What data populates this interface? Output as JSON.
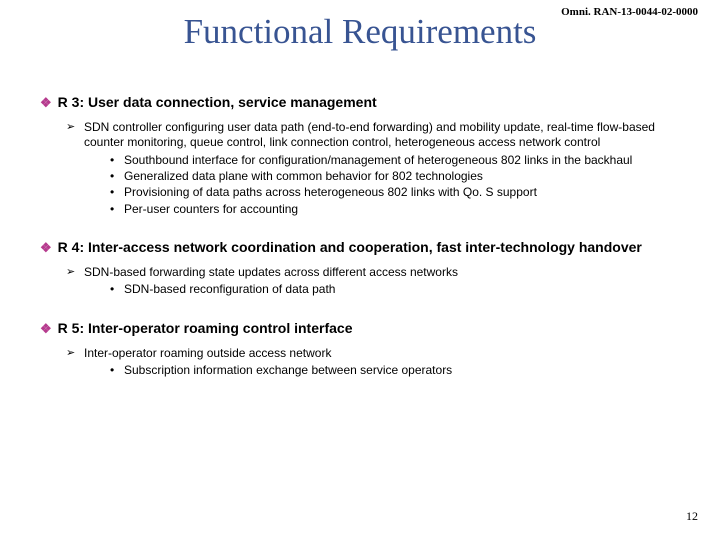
{
  "doc_id": "Omni. RAN-13-0044-02-0000",
  "title": "Functional Requirements",
  "sections": [
    {
      "heading": "R 3: User data connection, service management",
      "arrows": [
        {
          "text": "SDN controller configuring user data path (end-to-end forwarding) and mobility update, real-time flow-based counter monitoring, queue control, link connection control, heterogeneous access network control",
          "dots": [
            "Southbound interface for configuration/management of heterogeneous 802 links in the backhaul",
            "Generalized data plane with common behavior for 802 technologies",
            "Provisioning of data paths across heterogeneous 802 links with Qo. S support",
            "Per-user counters for accounting"
          ]
        }
      ]
    },
    {
      "heading": "R 4: Inter-access network coordination and cooperation, fast inter-technology handover",
      "arrows": [
        {
          "text": "SDN-based forwarding state updates across different access networks",
          "dots": [
            "SDN-based reconfiguration of data path"
          ]
        }
      ]
    },
    {
      "heading": "R 5: Inter-operator roaming control interface",
      "arrows": [
        {
          "text": "Inter-operator roaming outside access network",
          "dots": [
            "Subscription information exchange between service operators"
          ]
        }
      ]
    }
  ],
  "page_number": "12"
}
